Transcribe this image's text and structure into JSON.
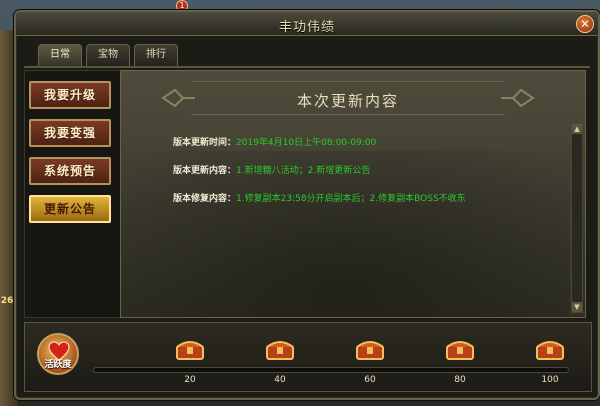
{
  "window": {
    "title": "丰功伟绩",
    "close_icon": "close-icon"
  },
  "background": {
    "badge_text": "1",
    "side_number": "26"
  },
  "tabs": [
    {
      "label": "日常",
      "active": true
    },
    {
      "label": "宝物",
      "active": false
    },
    {
      "label": "排行",
      "active": false
    }
  ],
  "sidebar": {
    "items": [
      {
        "label": "我要升级",
        "active": false
      },
      {
        "label": "我要变强",
        "active": false
      },
      {
        "label": "系统预告",
        "active": false
      },
      {
        "label": "更新公告",
        "active": true
      }
    ]
  },
  "content": {
    "title": "本次更新内容",
    "rows": [
      {
        "label": "版本更新时间：",
        "value": "2019年4月10日上午08:00-09:00"
      },
      {
        "label": "版本更新内容：",
        "value": "1.新增糖八活动；2.新增更新公告"
      },
      {
        "label": "版本修复内容：",
        "value": "1.修复副本23:58分开启副本后；2.修复副本BOSS不收东"
      }
    ]
  },
  "activity": {
    "label": "活跃度",
    "progress": 0.0,
    "milestones": [
      "20",
      "40",
      "60",
      "80",
      "100"
    ]
  },
  "colors": {
    "accent_gold": "#e1b43c",
    "value_green": "#2fc72b",
    "button_brown": "#7a3a22"
  }
}
